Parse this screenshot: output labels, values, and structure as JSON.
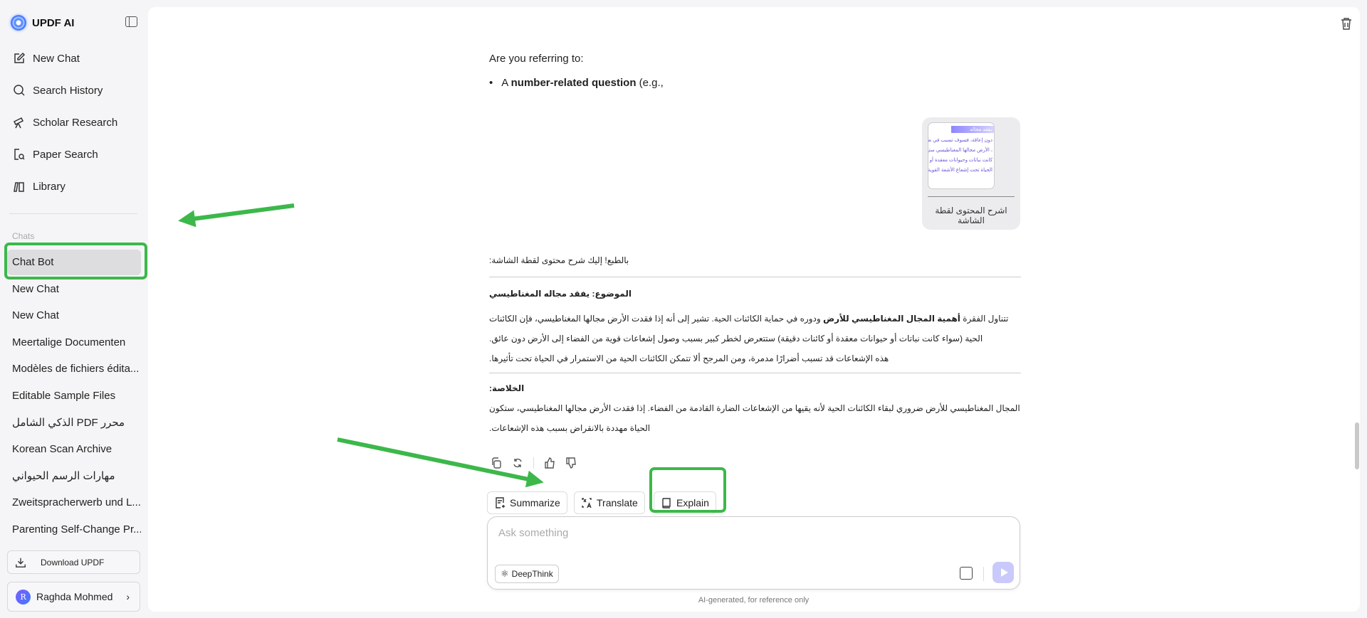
{
  "app": {
    "title": "UPDF AI"
  },
  "nav": [
    {
      "label": "New Chat",
      "icon": "edit-icon"
    },
    {
      "label": "Search History",
      "icon": "search-icon"
    },
    {
      "label": "Scholar Research",
      "icon": "telescope-icon"
    },
    {
      "label": "Paper Search",
      "icon": "paper-search-icon"
    },
    {
      "label": "Library",
      "icon": "library-icon"
    }
  ],
  "chats_label": "Chats",
  "chats": [
    "Chat Bot",
    "New Chat",
    "New Chat",
    "Meertalige Documenten",
    "Modèles de fichiers édita...",
    "Editable Sample Files",
    "الذكي الشامل PDF محرر",
    "Korean Scan Archive",
    "مهارات الرسم الحيواني",
    "Zweitspracherwerb und L...",
    "Parenting Self-Change Pr..."
  ],
  "download_label": "Download UPDF",
  "user": {
    "initial": "R",
    "name": "Raghda Mohmed"
  },
  "conversation": {
    "prev_intro": "Are you referring to:",
    "prev_bullet_prefix": "A ",
    "prev_bullet_bold": "number-related question",
    "prev_bullet_suffix": " (e.g.,",
    "user_message": {
      "thumb_lines": [
        "يفقد مجاله",
        "دون إعاقة، فسوف تسبب في ط",
        "، الأرض مجالها المغناطيسي ستح",
        "كانت نباتات وحيوانات معقدة أو كا",
        "الحياة تحت إشعاع الأشعة القوية"
      ],
      "caption": "اشرح المحتوى لقطة الشاشة"
    },
    "answer": {
      "intro": "بالطبع! إليك شرح محتوى لقطة الشاشة:",
      "topic": "الموضوع: يفقد مجاله المغناطيسي",
      "p1_start": "تتناول الفقرة ",
      "p1_bold": "أهمية المجال المغناطيسي للأرض",
      "p1_rest": " ودوره في حماية الكائنات الحية. تشير إلى أنه إذا فقدت الأرض مجالها المغناطيسي، فإن الكائنات الحية (سواء كانت نباتات أو حيوانات معقدة أو كائنات دقيقة) ستتعرض لخطر كبير بسبب وصول إشعاعات قوية من الفضاء إلى الأرض دون عائق.",
      "p2": "هذه الإشعاعات قد تسبب أضرارًا مدمرة، ومن المرجح ألا تتمكن الكائنات الحية من الاستمرار في الحياة تحت تأثيرها.",
      "summary_title": "الخلاصة:",
      "summary": "المجال المغناطيسي للأرض ضروري لبقاء الكائنات الحية لأنه يقيها من الإشعاعات الضارة القادمة من الفضاء. إذا فقدت الأرض مجالها المغناطيسي، ستكون الحياة مهددة بالانقراض بسبب هذه الإشعاعات."
    }
  },
  "quick_actions": [
    "Summarize",
    "Translate",
    "Explain"
  ],
  "input": {
    "placeholder": "Ask something",
    "deepthink": "DeepThink"
  },
  "footer": "AI-generated, for reference only",
  "colors": {
    "annotation": "#3cb84a",
    "send": "#c9c9fb"
  }
}
